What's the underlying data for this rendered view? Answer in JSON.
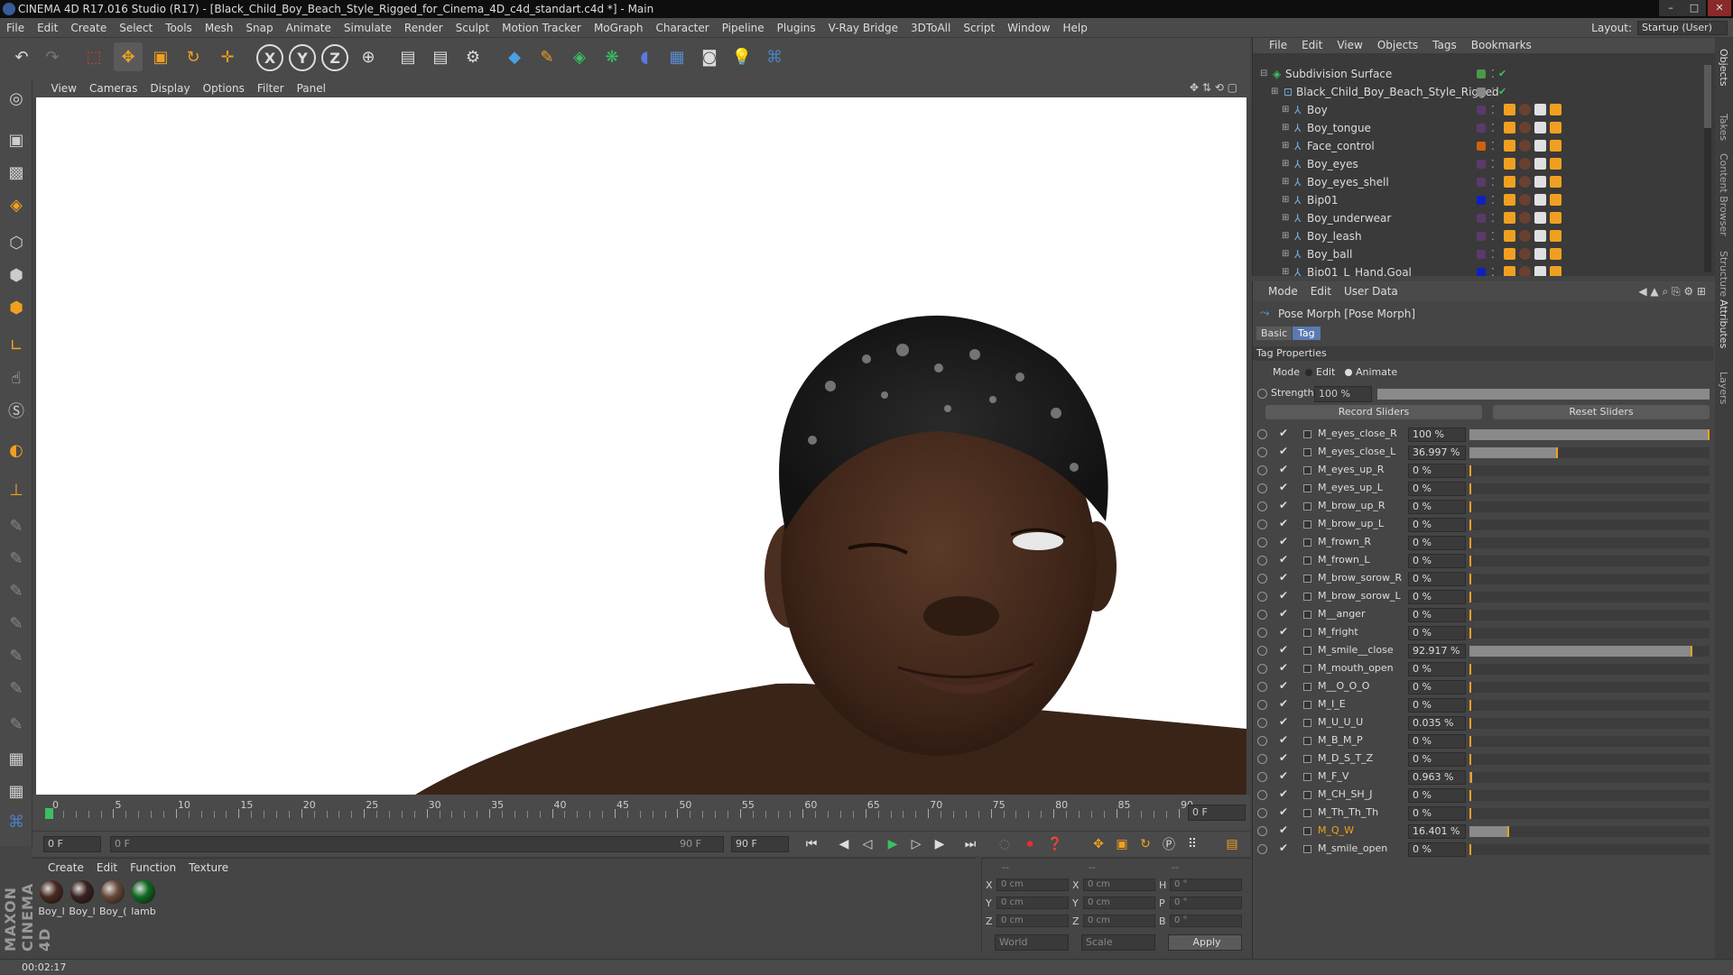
{
  "window": {
    "title": "CINEMA 4D R17.016 Studio (R17) - [Black_Child_Boy_Beach_Style_Rigged_for_Cinema_4D_c4d_standart.c4d *] - Main"
  },
  "menubar": {
    "items": [
      "File",
      "Edit",
      "Create",
      "Select",
      "Tools",
      "Mesh",
      "Snap",
      "Animate",
      "Simulate",
      "Render",
      "Sculpt",
      "Motion Tracker",
      "MoGraph",
      "Character",
      "Pipeline",
      "Plugins",
      "V-Ray Bridge",
      "3DToAll",
      "Script",
      "Window",
      "Help"
    ],
    "layout_label": "Layout:",
    "layout_value": "Startup (User)"
  },
  "toolbar": {
    "axis_x": "X",
    "axis_y": "Y",
    "axis_z": "Z"
  },
  "viewport": {
    "menu": [
      "View",
      "Cameras",
      "Display",
      "Options",
      "Filter",
      "Panel"
    ]
  },
  "timeline": {
    "ticks": [
      "0",
      "5",
      "10",
      "15",
      "20",
      "25",
      "30",
      "35",
      "40",
      "45",
      "50",
      "55",
      "60",
      "65",
      "70",
      "75",
      "80",
      "85",
      "90"
    ],
    "current_frame_right": "0 F",
    "start_field": "0 F",
    "range_start": "0 F",
    "range_end": "90 F",
    "end_field": "90 F"
  },
  "material_manager": {
    "menu": [
      "Create",
      "Edit",
      "Function",
      "Texture"
    ],
    "materials": [
      {
        "label": "Boy_l",
        "color": "#4a2a22"
      },
      {
        "label": "Boy_l",
        "color": "#3a2220"
      },
      {
        "label": "Boy_(",
        "color": "#6a4a3a"
      },
      {
        "label": "lamb",
        "color": "#0f6a20"
      }
    ]
  },
  "coordinates": {
    "header": [
      "--",
      "--",
      "--"
    ],
    "rows": [
      {
        "a": "X",
        "av": "0 cm",
        "b": "X",
        "bv": "0 cm",
        "c": "H",
        "cv": "0 °"
      },
      {
        "a": "Y",
        "av": "0 cm",
        "b": "Y",
        "bv": "0 cm",
        "c": "P",
        "cv": "0 °"
      },
      {
        "a": "Z",
        "av": "0 cm",
        "b": "Z",
        "bv": "0 cm",
        "c": "B",
        "cv": "0 °"
      }
    ],
    "world": "World",
    "scale": "Scale",
    "apply": "Apply"
  },
  "statusbar": {
    "time": "00:02:17"
  },
  "object_manager": {
    "menu": [
      "File",
      "Edit",
      "View",
      "Objects",
      "Tags",
      "Bookmarks"
    ],
    "objects": [
      {
        "name": "Subdivision Surface",
        "indent": 0,
        "color": "#4a9a4a"
      },
      {
        "name": "Black_Child_Boy_Beach_Style_Rigged",
        "indent": 1,
        "color": "#888888"
      },
      {
        "name": "Boy",
        "indent": 2,
        "color": "#5a3a6a"
      },
      {
        "name": "Boy_tongue",
        "indent": 2,
        "color": "#5a3a6a"
      },
      {
        "name": "Face_control",
        "indent": 2,
        "color": "#d06010"
      },
      {
        "name": "Boy_eyes",
        "indent": 2,
        "color": "#5a3a6a"
      },
      {
        "name": "Boy_eyes_shell",
        "indent": 2,
        "color": "#5a3a6a"
      },
      {
        "name": "Bip01",
        "indent": 2,
        "color": "#1020c0"
      },
      {
        "name": "Boy_underwear",
        "indent": 2,
        "color": "#5a3a6a"
      },
      {
        "name": "Boy_leash",
        "indent": 2,
        "color": "#5a3a6a"
      },
      {
        "name": "Boy_ball",
        "indent": 2,
        "color": "#5a3a6a"
      },
      {
        "name": "Bip01_L_Hand.Goal",
        "indent": 2,
        "color": "#1020c0"
      }
    ]
  },
  "attributes": {
    "menu": [
      "Mode",
      "Edit",
      "User Data"
    ],
    "object_title": "Pose Morph [Pose Morph]",
    "tab_basic": "Basic",
    "tab_tag": "Tag",
    "section": "Tag Properties",
    "mode_label": "Mode",
    "mode_edit": "Edit",
    "mode_animate": "Animate",
    "strength_label": "Strength",
    "strength_value": "100 %",
    "record_sliders": "Record Sliders",
    "reset_sliders": "Reset Sliders",
    "morphs": [
      {
        "name": "M_eyes_close_R",
        "value": "100 %",
        "level": 1.0
      },
      {
        "name": "M_eyes_close_L",
        "value": "36.997 %",
        "level": 0.37
      },
      {
        "name": "M_eyes_up_R",
        "value": "0 %",
        "level": 0
      },
      {
        "name": "M_eyes_up_L",
        "value": "0 %",
        "level": 0
      },
      {
        "name": "M_brow_up_R",
        "value": "0 %",
        "level": 0
      },
      {
        "name": "M_brow_up_L",
        "value": "0 %",
        "level": 0
      },
      {
        "name": "M_frown_R",
        "value": "0 %",
        "level": 0
      },
      {
        "name": "M_frown_L",
        "value": "0 %",
        "level": 0
      },
      {
        "name": "M_brow_sorow_R",
        "value": "0 %",
        "level": 0
      },
      {
        "name": "M_brow_sorow_L",
        "value": "0 %",
        "level": 0
      },
      {
        "name": "M__anger",
        "value": "0 %",
        "level": 0
      },
      {
        "name": "M_fright",
        "value": "0 %",
        "level": 0
      },
      {
        "name": "M_smile__close",
        "value": "92.917 %",
        "level": 0.929
      },
      {
        "name": "M_mouth_open",
        "value": "0 %",
        "level": 0
      },
      {
        "name": "M__O_O_O",
        "value": "0 %",
        "level": 0
      },
      {
        "name": "M_I_E",
        "value": "0 %",
        "level": 0
      },
      {
        "name": "M_U_U_U",
        "value": "0.035 %",
        "level": 0.0004
      },
      {
        "name": "M_B_M_P",
        "value": "0 %",
        "level": 0
      },
      {
        "name": "M_D_S_T_Z",
        "value": "0 %",
        "level": 0
      },
      {
        "name": "M_F_V",
        "value": "0.963 %",
        "level": 0.01
      },
      {
        "name": "M_CH_SH_J",
        "value": "0 %",
        "level": 0
      },
      {
        "name": "M_Th_Th_Th",
        "value": "0 %",
        "level": 0
      },
      {
        "name": "M_Q_W",
        "value": "16.401 %",
        "level": 0.164,
        "highlight": true
      },
      {
        "name": "M_smile_open",
        "value": "0 %",
        "level": 0
      }
    ]
  },
  "right_tabs": [
    "Objects",
    "Takes",
    "Content Browser",
    "Structure",
    "Attributes",
    "Layers"
  ],
  "brand": "MAXON CINEMA 4D"
}
